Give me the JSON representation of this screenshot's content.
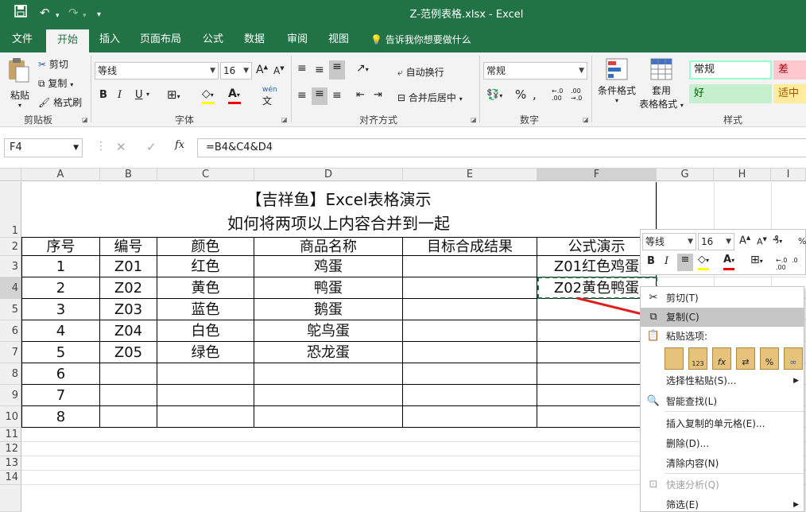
{
  "title_bar": {
    "title": "Z-范例表格.xlsx  -  Excel"
  },
  "tabs": [
    "文件",
    "开始",
    "插入",
    "页面布局",
    "公式",
    "数据",
    "审阅",
    "视图"
  ],
  "tell_me": "告诉我你想要做什么",
  "ribbon": {
    "clipboard": {
      "paste": "粘贴",
      "cut": "剪切",
      "copy": "复制",
      "format_painter": "格式刷",
      "label": "剪贴板"
    },
    "font": {
      "name": "等线",
      "size": "16",
      "label": "字体",
      "bold": "B",
      "italic": "I",
      "underline": "U"
    },
    "alignment": {
      "wrap": "自动换行",
      "merge": "合并后居中",
      "label": "对齐方式"
    },
    "number": {
      "format": "常规",
      "label": "数字",
      "percent": "%"
    },
    "styles": {
      "conditional": "条件格式",
      "table_l1": "套用",
      "table_l2": "表格格式",
      "label": "样式",
      "normal": "常规",
      "bad": "差",
      "good": "好",
      "neutral": "适中"
    }
  },
  "formula_bar": {
    "name_box": "F4",
    "fx": "fx",
    "formula": "=B4&C4&D4"
  },
  "columns": [
    "A",
    "B",
    "C",
    "D",
    "E",
    "F",
    "G",
    "H",
    "I"
  ],
  "rows": [
    "1",
    "2",
    "3",
    "4",
    "5",
    "6",
    "7",
    "8",
    "9",
    "10",
    "11",
    "12",
    "13",
    "14"
  ],
  "sheet": {
    "title_line1": "【吉祥鱼】Excel表格演示",
    "title_line2": "如何将两项以上内容合并到一起",
    "headers": [
      "序号",
      "编号",
      "颜色",
      "商品名称",
      "目标合成结果",
      "公式演示"
    ],
    "data": [
      [
        "1",
        "Z01",
        "红色",
        "鸡蛋",
        "",
        "Z01红色鸡蛋"
      ],
      [
        "2",
        "Z02",
        "黄色",
        "鸭蛋",
        "",
        "Z02黄色鸭蛋"
      ],
      [
        "3",
        "Z03",
        "蓝色",
        "鹅蛋",
        "",
        ""
      ],
      [
        "4",
        "Z04",
        "白色",
        "鸵鸟蛋",
        "",
        ""
      ],
      [
        "5",
        "Z05",
        "绿色",
        "恐龙蛋",
        "",
        ""
      ],
      [
        "6",
        "",
        "",
        "",
        "",
        ""
      ],
      [
        "7",
        "",
        "",
        "",
        "",
        ""
      ],
      [
        "8",
        "",
        "",
        "",
        "",
        ""
      ]
    ]
  },
  "mini_toolbar": {
    "font": "等线",
    "size": "16",
    "bold": "B",
    "italic": "I"
  },
  "context_menu": {
    "cut": "剪切(T)",
    "copy": "复制(C)",
    "paste_options": "粘贴选项:",
    "paste_special": "选择性粘贴(S)...",
    "smart_lookup": "智能查找(L)",
    "insert_copied": "插入复制的单元格(E)...",
    "delete": "删除(D)...",
    "clear": "清除内容(N)",
    "quick_analysis": "快速分析(Q)",
    "filter": "筛选(E)"
  },
  "colors": {
    "excel_green": "#217346",
    "arrow": "#e02020"
  }
}
